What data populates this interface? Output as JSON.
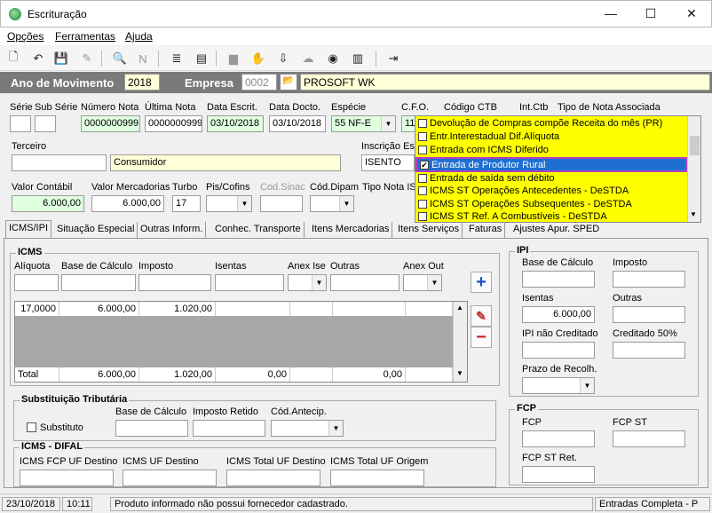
{
  "window": {
    "title": "Escrituração",
    "minimize": "—",
    "maximize": "☐",
    "close": "✕"
  },
  "menu": {
    "opcoes": "Opções",
    "ferramentas": "Ferramentas",
    "ajuda": "Ajuda"
  },
  "header": {
    "ano_label": "Ano de Movimento",
    "ano_value": "2018",
    "empresa_label": "Empresa",
    "empresa_code": "0002",
    "empresa_name": "PROSOFT WK"
  },
  "fields": {
    "serie_label": "Série",
    "subserie_label": "Sub Série",
    "numero_label": "Número Nota",
    "numero_value": "0000000999",
    "ultima_label": "Última Nota",
    "ultima_value": "0000000999",
    "data_escrit_label": "Data Escrit.",
    "data_escrit_value": "03/10/2018",
    "data_docto_label": "Data Docto.",
    "data_docto_value": "03/10/2018",
    "especie_label": "Espécie",
    "especie_value": "55  NF-E",
    "cfo_label": "C.F.O.",
    "cfo_value": "11",
    "codigo_ctb_label": "Código CTB",
    "int_ctb_label": "Int.Ctb",
    "tipo_nota_label": "Tipo de Nota Associada",
    "terceiro_label": "Terceiro",
    "terceiro_name": "Consumidor",
    "inscricao_label": "Inscrição Est",
    "inscricao_value": "ISENTO",
    "valor_contabil_label": "Valor Contábil",
    "valor_contabil_value": "6.000,00",
    "valor_merc_label": "Valor Mercadorias",
    "valor_merc_value": "6.000,00",
    "turbo_label": "Turbo",
    "turbo_value": "17",
    "pis_label": "Pis/Cofins",
    "cod_sinac_label": "Cod.Sinac",
    "cod_dipam_label": "Cód.Dipam",
    "tipo_nota_is_label": "Tipo Nota IS"
  },
  "dropdown": [
    {
      "label": "Devolução de Compras compõe Receita do mês (PR)",
      "checked": false
    },
    {
      "label": "Entr.Interestadual Dif.Alíquota",
      "checked": false
    },
    {
      "label": "Entrada com ICMS Diferido",
      "checked": false
    },
    {
      "label": "Entrada de Produtor Rural",
      "checked": true
    },
    {
      "label": "Entrada de saída sem débito",
      "checked": false
    },
    {
      "label": "ICMS ST Operações Antecedentes - DeSTDA",
      "checked": false
    },
    {
      "label": "ICMS ST Operações Subsequentes - DeSTDA",
      "checked": false
    },
    {
      "label": "ICMS ST Ref. A Combustíveis - DeSTDA",
      "checked": false
    }
  ],
  "tabs": [
    "ICMS/IPI",
    "Situação Especial",
    "Outras Inform.",
    "Conhec. Transporte",
    "Itens Mercadorias",
    "Itens Serviços",
    "Faturas",
    "Ajustes Apur. SPED"
  ],
  "icms": {
    "title": "ICMS",
    "aliquota": "Alíquota",
    "base": "Base de Cálculo",
    "imposto": "Imposto",
    "isentas": "Isentas",
    "anex_ise": "Anex Ise",
    "outras": "Outras",
    "anex_out": "Anex Out",
    "row": [
      "17,0000",
      "6.000,00",
      "1.020,00"
    ],
    "total_label": "Total",
    "total": [
      "6.000,00",
      "1.020,00",
      "0,00",
      "0,00"
    ]
  },
  "st": {
    "title": "Substituição Tributária",
    "substituto": "Substituto",
    "base": "Base de Cálculo",
    "imposto_retido": "Imposto Retido",
    "cod_antecip": "Cód.Antecip."
  },
  "difal": {
    "title": "ICMS - DIFAL",
    "fcp_uf": "ICMS FCP UF Destino",
    "uf_dest": "ICMS UF Destino",
    "total_dest": "ICMS Total UF Destino",
    "total_orig": "ICMS Total UF Origem"
  },
  "ipi": {
    "title": "IPI",
    "base": "Base de Cálculo",
    "imposto": "Imposto",
    "isentas": "Isentas",
    "isentas_value": "6.000,00",
    "outras": "Outras",
    "nao_cred": "IPI não Creditado",
    "cred50": "Creditado 50%",
    "prazo": "Prazo de Recolh."
  },
  "fcp": {
    "title": "FCP",
    "fcp": "FCP",
    "fcp_st": "FCP ST",
    "fcp_st_ret": "FCP ST Ret."
  },
  "status": {
    "date": "23/10/2018",
    "time": "10:11",
    "message": "Produto informado não possui fornecedor cadastrado.",
    "mode": "Entradas Completa - P"
  },
  "colors": {
    "header_bg": "#7a7a7a",
    "dropdown_bg": "#ffff00",
    "selected": "#1e6fd0",
    "input_green": "#dfffdf",
    "input_yellow": "#ffffd8"
  }
}
